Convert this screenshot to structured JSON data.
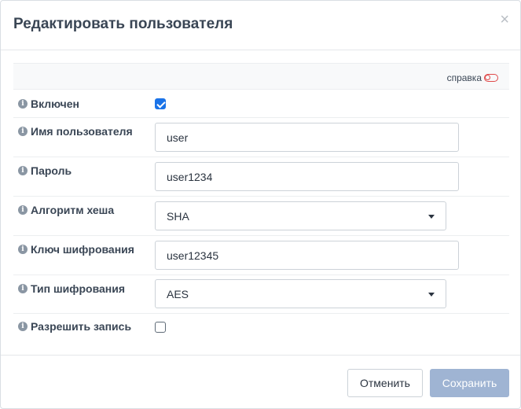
{
  "dialog": {
    "title": "Редактировать пользователя",
    "close_symbol": "×"
  },
  "help": {
    "label": "справка",
    "toggle_icon": "toggle-off-icon",
    "toggle_color": "#e04a4a"
  },
  "fields": {
    "enabled": {
      "label": "Включен",
      "checked": true
    },
    "username": {
      "label": "Имя пользователя",
      "value": "user"
    },
    "password": {
      "label": "Пароль",
      "value": "user1234"
    },
    "hash_algorithm": {
      "label": "Алгоритм хеша",
      "value": "SHA"
    },
    "encryption_key": {
      "label": "Ключ шифрования",
      "value": "user12345"
    },
    "encryption_type": {
      "label": "Тип шифрования",
      "value": "AES"
    },
    "allow_write": {
      "label": "Разрешить запись",
      "checked": false
    }
  },
  "footer": {
    "cancel_label": "Отменить",
    "save_label": "Сохранить"
  },
  "colors": {
    "accent": "#1a73e8",
    "save_button_disabled": "#9fb4d3"
  }
}
